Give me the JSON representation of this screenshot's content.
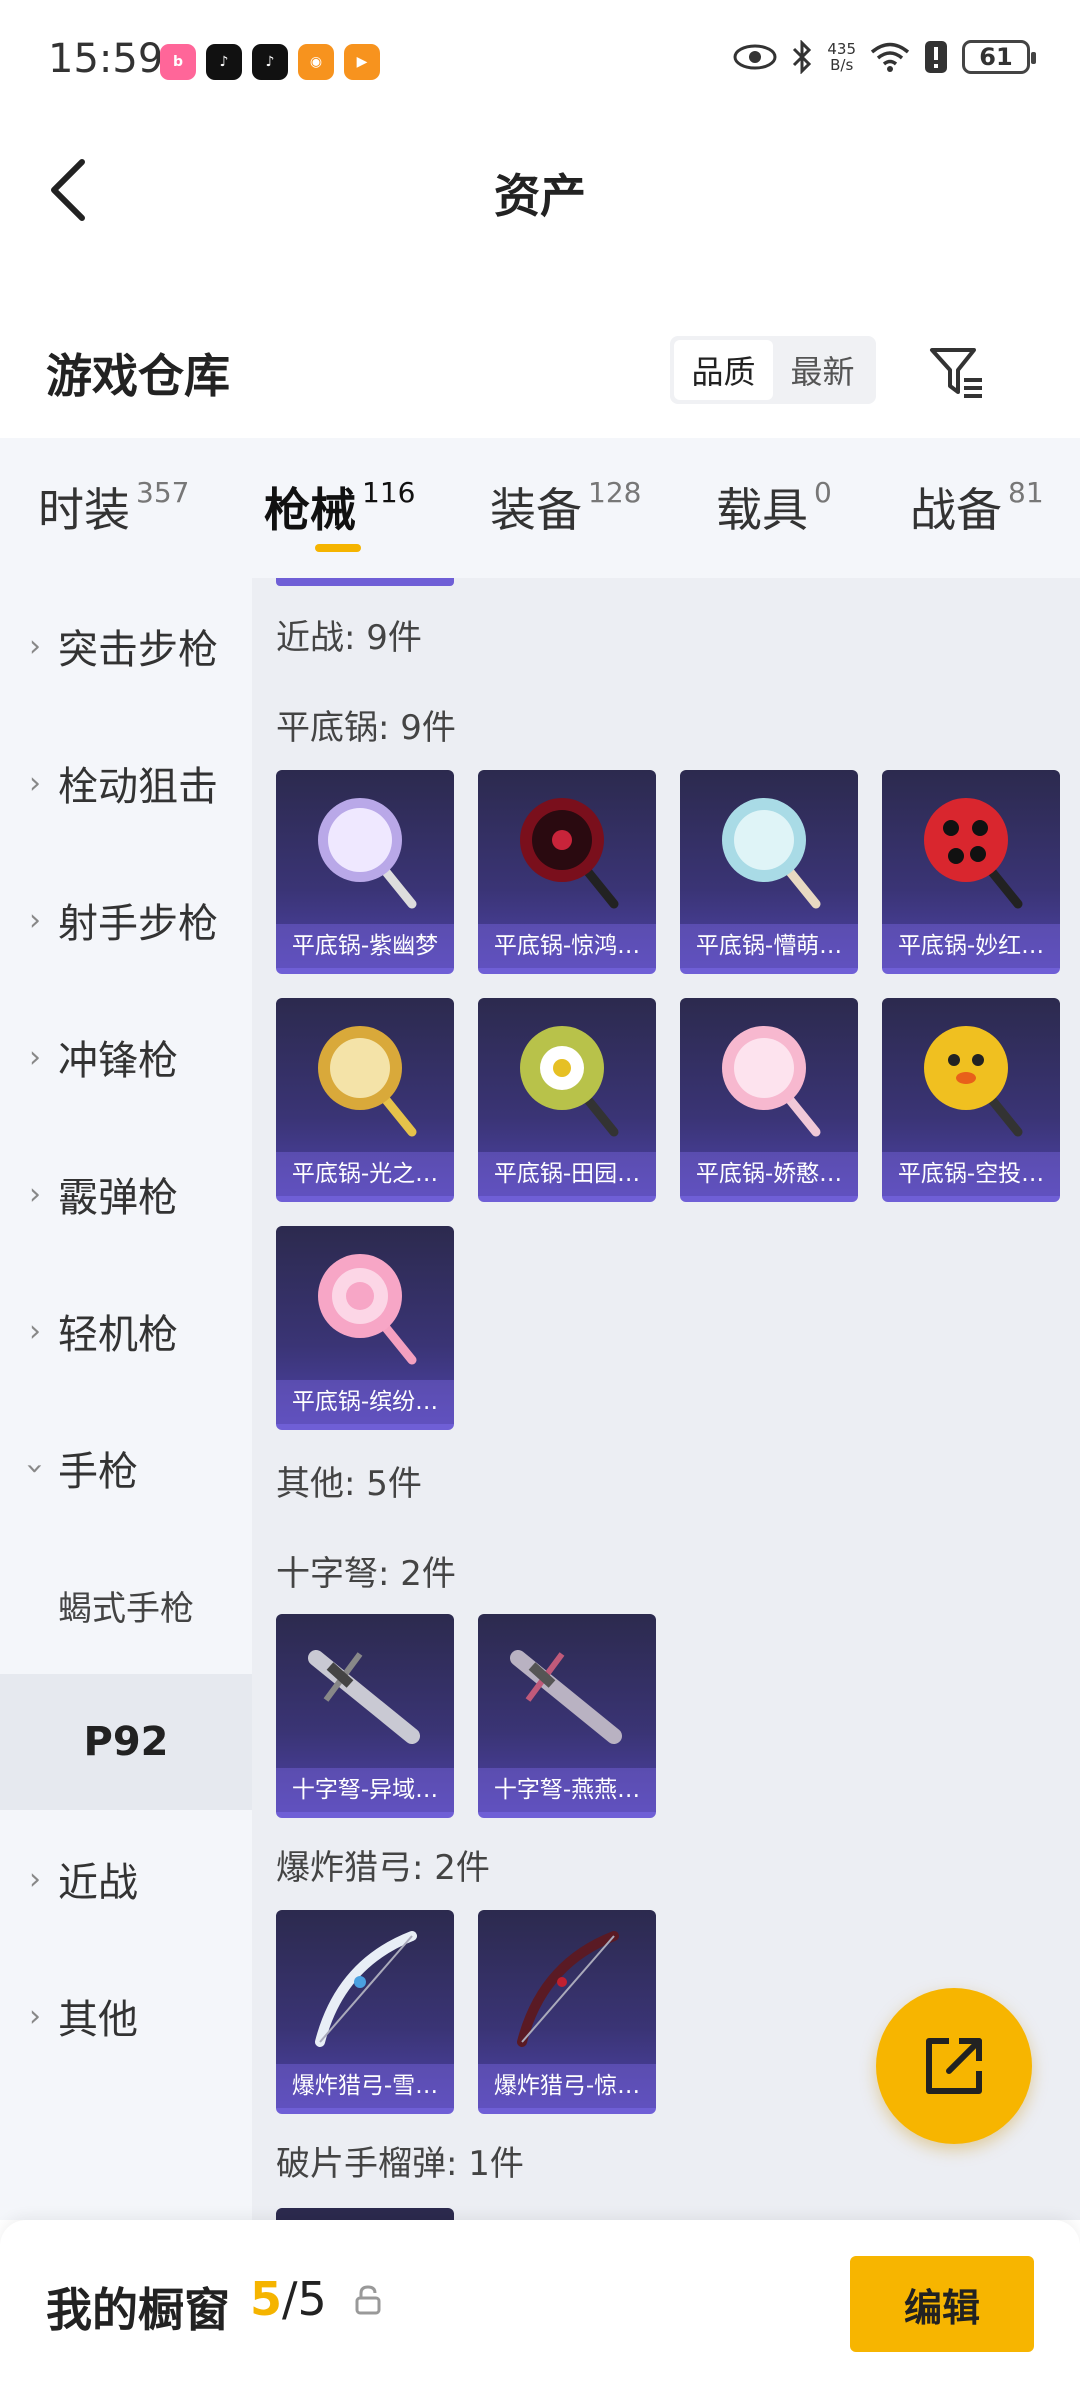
{
  "status_bar": {
    "time": "15:59",
    "net_speed": "435",
    "net_unit": "B/s",
    "battery": "61",
    "apps": [
      "bilibili",
      "douyin",
      "douyin",
      "game",
      "player"
    ]
  },
  "header": {
    "title": "资产"
  },
  "warehouse": {
    "title": "游戏仓库",
    "sort_options": [
      "品质",
      "最新"
    ],
    "selected_sort": "品质"
  },
  "tabs": [
    {
      "label": "时装",
      "count": "357"
    },
    {
      "label": "枪械",
      "count": "116"
    },
    {
      "label": "装备",
      "count": "128"
    },
    {
      "label": "载具",
      "count": "0"
    },
    {
      "label": "战备",
      "count": "81"
    }
  ],
  "active_tab": "枪械",
  "sidebar": {
    "items": [
      {
        "label": "突击步枪",
        "expanded": false
      },
      {
        "label": "栓动狙击",
        "expanded": false
      },
      {
        "label": "射手步枪",
        "expanded": false
      },
      {
        "label": "冲锋枪",
        "expanded": false
      },
      {
        "label": "霰弹枪",
        "expanded": false
      },
      {
        "label": "轻机枪",
        "expanded": false
      },
      {
        "label": "手枪",
        "expanded": true
      },
      {
        "label": "近战",
        "expanded": false
      },
      {
        "label": "其他",
        "expanded": false
      }
    ],
    "sub_items": [
      "蝎式手枪",
      "P92"
    ],
    "selected_sub": "P92"
  },
  "content": {
    "headings": {
      "melee": "近战: 9件",
      "pan": "平底锅: 9件",
      "other": "其他: 5件",
      "crossbow": "十字弩: 2件",
      "bow": "爆炸猎弓: 2件",
      "grenade": "破片手榴弹: 1件"
    },
    "pan_items": [
      "平底锅-紫幽梦",
      "平底锅-惊鸿…",
      "平底锅-懵萌…",
      "平底锅-妙红…",
      "平底锅-光之…",
      "平底锅-田园…",
      "平底锅-娇憨…",
      "平底锅-空投…",
      "平底锅-缤纷…"
    ],
    "crossbow_items": [
      "十字弩-异域…",
      "十字弩-燕燕…"
    ],
    "bow_items": [
      "爆炸猎弓-雪…",
      "爆炸猎弓-惊…"
    ]
  },
  "bottom_bar": {
    "title": "我的橱窗",
    "count_current": "5",
    "count_sep": "/",
    "count_total": "5",
    "edit_label": "编辑"
  },
  "colors": {
    "accent": "#f7b500",
    "card_bg": "#3a3475",
    "card_border": "#6f5fd6"
  }
}
